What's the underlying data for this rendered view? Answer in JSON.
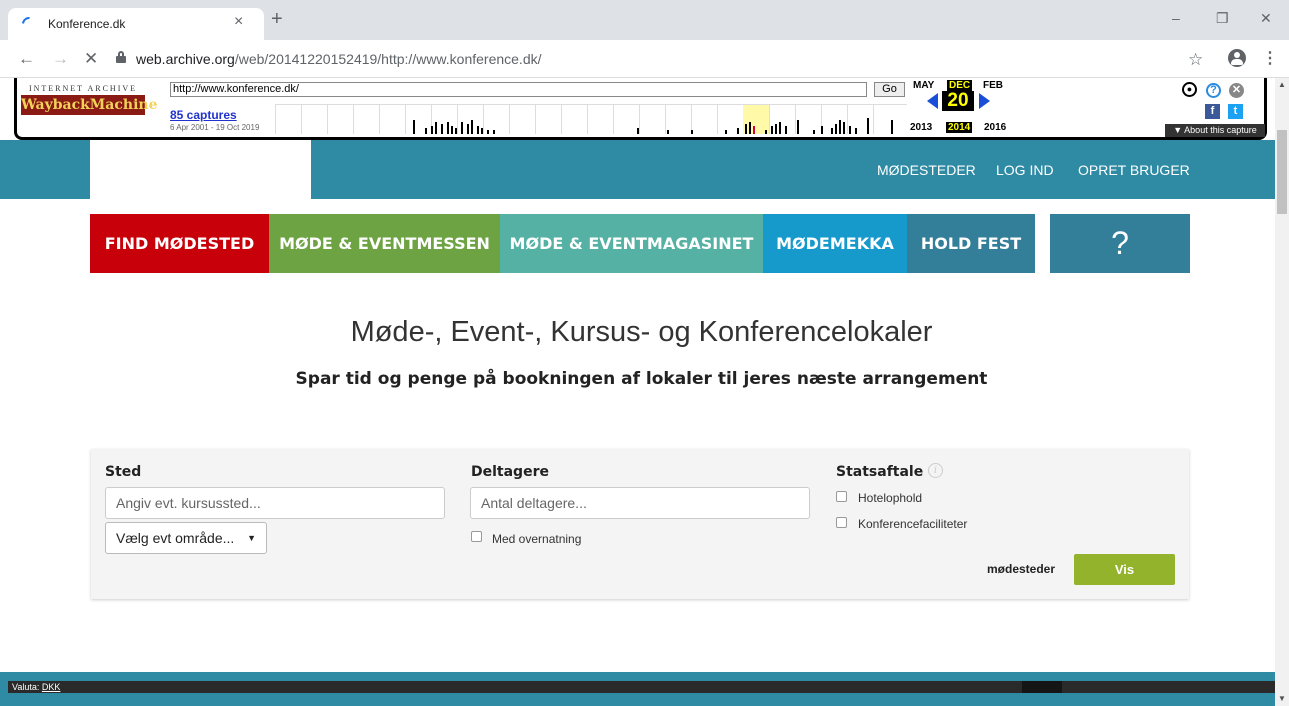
{
  "browser": {
    "tab_title": "Konference.dk",
    "tab_close": "×",
    "new_tab": "+",
    "url_host": "web.archive.org",
    "url_path": "/web/20141220152419/http://www.konference.dk/",
    "win_min": "–",
    "win_restore": "❐",
    "win_close": "✕",
    "back": "←",
    "forward": "→",
    "stop": "✕",
    "star": "☆",
    "kebab": "⋮"
  },
  "wayback": {
    "logo_top": "INTERNET ARCHIVE",
    "logo_main": "WaybackMachine",
    "url_value": "http://www.konference.dk/",
    "go": "Go",
    "captures": "85 captures",
    "range": "6 Apr 2001 - 19 Oct 2019",
    "prev_month": "MAY",
    "cur_month": "DEC",
    "next_month": "FEB",
    "day": "20",
    "prev_year": "2013",
    "cur_year": "2014",
    "next_year": "2016",
    "about": "▼ About this capture"
  },
  "site": {
    "topnav": [
      "MØDESTEDER",
      "LOG IND",
      "OPRET BRUGER"
    ],
    "menu": [
      {
        "label": "FIND MØDESTED",
        "color": "#c8000a"
      },
      {
        "label": "MØDE & EVENTMESSEN",
        "color": "#6ea343"
      },
      {
        "label": "MØDE & EVENTMAGASINET",
        "color": "#55b1a3"
      },
      {
        "label": "MØDEMEKKA",
        "color": "#1699cb"
      },
      {
        "label": "HOLD FEST",
        "color": "#337e98"
      },
      {
        "label": "?",
        "color": "#337e98"
      }
    ],
    "title": "Møde-, Event-, Kursus- og Konferencelokaler",
    "subtitle": "Spar tid og penge på bookningen af lokaler til jeres næste arrangement"
  },
  "search": {
    "sted_label": "Sted",
    "sted_placeholder": "Angiv evt. kursussted...",
    "area_select": "Vælg evt område...",
    "deltagere_label": "Deltagere",
    "deltagere_placeholder": "Antal deltagere...",
    "overnatning": "Med overnatning",
    "statsaftale_label": "Statsaftale",
    "hotelophold": "Hotelophold",
    "konferencefaciliteter": "Konferencefaciliteter",
    "count_label": "mødesteder",
    "vis": "Vis"
  },
  "footer": {
    "valuta_label": "Valuta:",
    "valuta_value": "DKK"
  }
}
